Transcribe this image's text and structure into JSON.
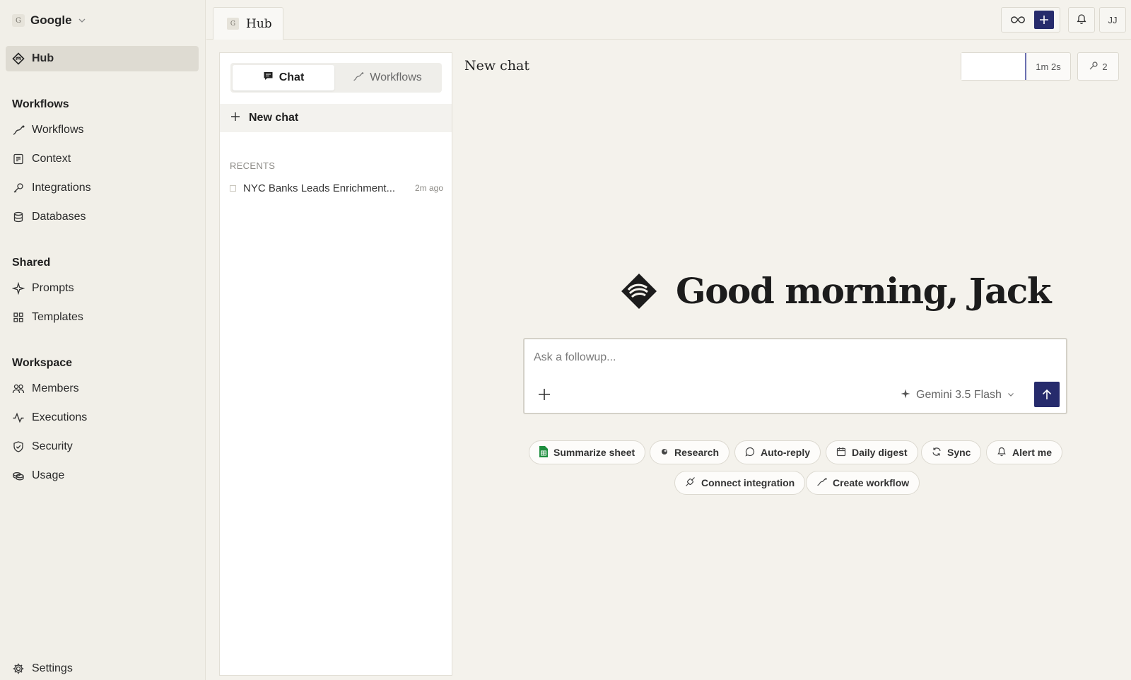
{
  "workspace": {
    "badge": "G",
    "name": "Google"
  },
  "sidebar": {
    "hub": "Hub",
    "sections": {
      "workflows": "Workflows",
      "shared": "Shared",
      "workspace": "Workspace"
    },
    "items": {
      "workflows": "Workflows",
      "context": "Context",
      "integrations": "Integrations",
      "databases": "Databases",
      "prompts": "Prompts",
      "templates": "Templates",
      "members": "Members",
      "executions": "Executions",
      "security": "Security",
      "usage": "Usage",
      "settings": "Settings"
    }
  },
  "topbar": {
    "tab": {
      "badge": "G",
      "label": "Hub"
    },
    "avatar": "JJ"
  },
  "list": {
    "tabs": {
      "chat": "Chat",
      "workflows": "Workflows"
    },
    "new_chat": "New chat",
    "recents_heading": "RECENTS",
    "recents": [
      {
        "name": "NYC Banks Leads Enrichment...",
        "time": "2m ago"
      }
    ]
  },
  "main": {
    "title": "New chat",
    "timer": "1m 2s",
    "keys_count": "2",
    "greeting": "Good morning, Jack",
    "composer": {
      "placeholder": "Ask a followup...",
      "model": "Gemini 3.5 Flash"
    },
    "chips": {
      "summarize": "Summarize sheet",
      "research": "Research",
      "autoreply": "Auto-reply",
      "digest": "Daily digest",
      "sync": "Sync",
      "alert": "Alert me",
      "connect": "Connect integration",
      "create": "Create workflow"
    }
  },
  "colors": {
    "accent": "#262b6c",
    "sidebar_bg": "#f1efe8",
    "sheet_green": "#1e8e3e"
  }
}
